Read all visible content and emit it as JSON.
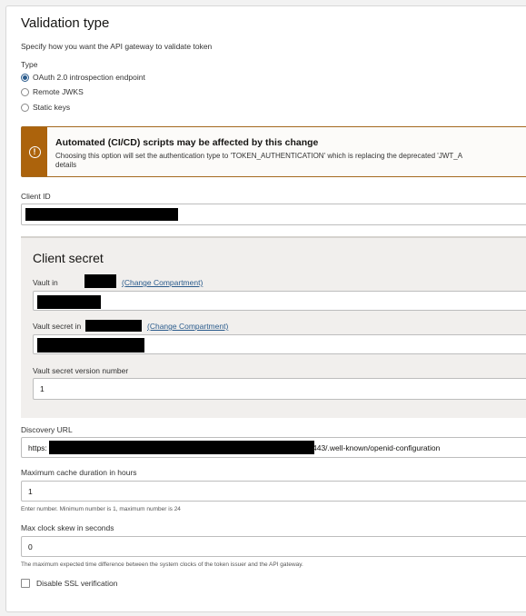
{
  "section": {
    "title": "Validation type",
    "lead": "Specify how you want the API gateway to validate token"
  },
  "type": {
    "label": "Type",
    "options": [
      {
        "label": "OAuth 2.0 introspection endpoint",
        "selected": true
      },
      {
        "label": "Remote JWKS",
        "selected": false
      },
      {
        "label": "Static keys",
        "selected": false
      }
    ]
  },
  "notice": {
    "title": "Automated (CI/CD) scripts may be affected by this change",
    "body_line1": "Choosing this option will set the authentication type to 'TOKEN_AUTHENTICATION' which is replacing the deprecated 'JWT_A",
    "body_line2": "details",
    "icon": "warning-icon",
    "color": "#ac630c"
  },
  "client_id": {
    "label": "Client ID"
  },
  "client_secret": {
    "title": "Client secret",
    "vault_label": "Vault in",
    "vault_change": "(Change Compartment)",
    "vault_secret_label": "Vault secret in",
    "vault_secret_change": "(Change Compartment)",
    "version_label": "Vault secret version number",
    "version_value": "1"
  },
  "discovery": {
    "label": "Discovery URL",
    "prefix": "https:",
    "suffix": "443/.well-known/openid-configuration"
  },
  "cache": {
    "label": "Maximum cache duration in hours",
    "value": "1",
    "hint": "Enter number. Minimum number is 1, maximum number is 24"
  },
  "skew": {
    "label": "Max clock skew in seconds",
    "value": "0",
    "hint": "The maximum expected time difference between the system clocks of the token issuer and the API gateway."
  },
  "ssl": {
    "label": "Disable SSL verification",
    "checked": false
  }
}
